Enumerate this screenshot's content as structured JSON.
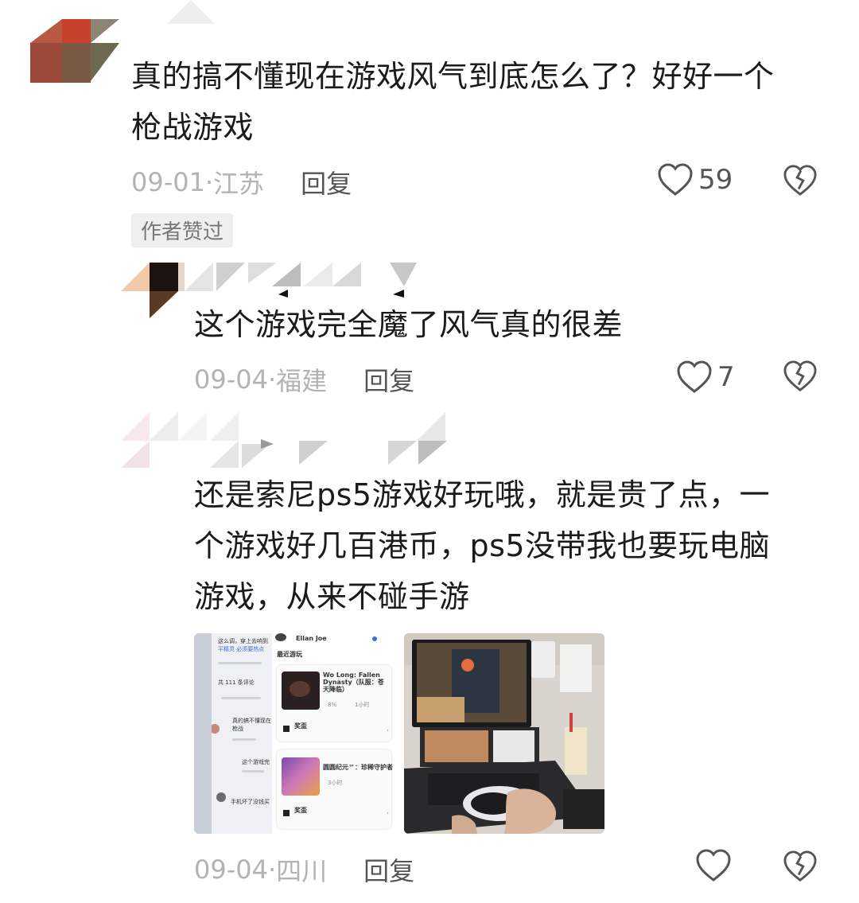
{
  "comments": [
    {
      "text_line1": "真的搞不懂现在游戏风气到底怎么了？好好一个",
      "text_line2": "枪战游戏",
      "date": "09-01",
      "location": "江苏",
      "reply_label": "回复",
      "likes": "59",
      "badge": "作者赞过"
    },
    {
      "text_line1": "这个游戏完全魔了风气真的很差",
      "date": "09-04",
      "location": "福建",
      "reply_label": "回复",
      "likes": "7"
    },
    {
      "text_line1": "还是索尼ps5游戏好玩哦，就是贵了点，一",
      "text_line2": "个游戏好几百港币，ps5没带我也要玩电脑",
      "text_line3": "游戏，从来不碰手游",
      "date": "09-04",
      "location": "四川",
      "reply_label": "回复",
      "likes": ""
    }
  ],
  "separator": " · ",
  "thumb1": {
    "user": "Ellan Joe",
    "section": "最近游玩",
    "game1_title": "Wo Long: Fallen Dynasty（队服：苍天降临）",
    "game1_stat1": "8%",
    "game1_stat2": "1小时",
    "trophy_label": "奖盃",
    "game2_title": "圆圆纪元™：珍稀守护者",
    "game2_stat": "3小时",
    "left_lines": [
      "这么调，穿上去响到",
      "平精灵 必须要热点",
      "共 111 条评论",
      "真的搞不懂现在",
      "枪战",
      "这个游戏完",
      "手机坏了没钱买"
    ]
  },
  "icons": {
    "like": "heart-outline-icon",
    "dislike": "broken-heart-icon"
  }
}
